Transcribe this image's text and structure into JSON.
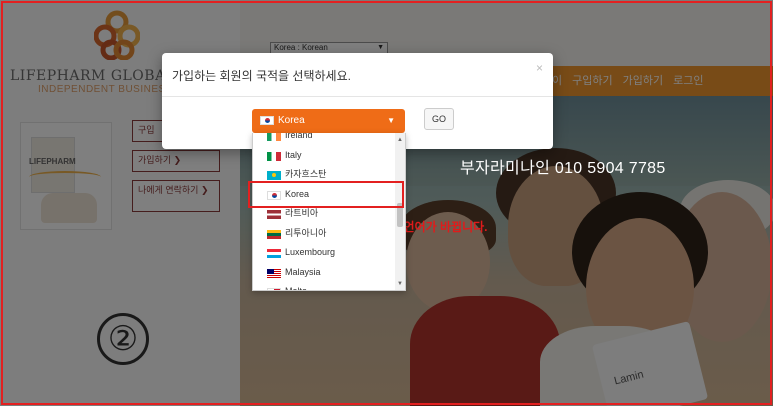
{
  "background_page": {
    "brand_name": "LIFEPHARM GLOBAL N",
    "brand_sub": "INDEPENDENT BUSINESS",
    "product_card_title": "LIFEPHARM",
    "side_buttons": [
      "구입",
      "가입하기 ❯",
      "나에게 연락하기 ❯"
    ],
    "lang_select": "Korea : Korean",
    "nav_items": [
      "이",
      "구입하기",
      "가입하기",
      "로그인"
    ],
    "hero_product_text": "Lamin",
    "circle_number": "②"
  },
  "annotations": {
    "phone": "부자라미나인 010 5904 7785",
    "red_note": "선택하시면 언어가 바뀝니다."
  },
  "modal": {
    "title": "가입하는 회원의 국적을 선택하세요.",
    "close": "×",
    "selected_country": "Korea",
    "selected_flag": "flag-korea",
    "go_label": "GO"
  },
  "dropdown": {
    "options": [
      {
        "label": "Ireland",
        "flag": "f-ie"
      },
      {
        "label": "Italy",
        "flag": "f-it"
      },
      {
        "label": "카자흐스탄",
        "flag": "f-kz"
      },
      {
        "label": "Korea",
        "flag": "f-kr"
      },
      {
        "label": "라트비아",
        "flag": "f-lv"
      },
      {
        "label": "리투아니아",
        "flag": "f-lt"
      },
      {
        "label": "Luxembourg",
        "flag": "f-lu"
      },
      {
        "label": "Malaysia",
        "flag": "f-my"
      },
      {
        "label": "Malta",
        "flag": "f-mt"
      }
    ],
    "highlighted": "Korea"
  },
  "colors": {
    "accent_orange": "#ef6c17",
    "nav_orange": "#f0962e",
    "annotation_red": "#e32020"
  }
}
